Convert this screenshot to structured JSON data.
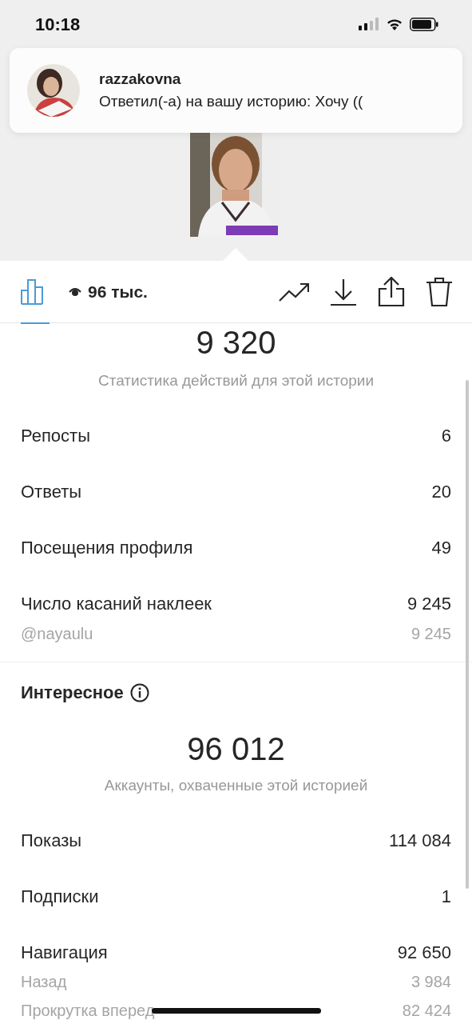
{
  "status_bar": {
    "time": "10:18"
  },
  "notification": {
    "username": "razzakovna",
    "message": "Ответил(-а) на вашу историю: Хочу (("
  },
  "toolbar": {
    "views": "96 тыс.",
    "tabs": [
      {
        "kind": "insights",
        "selected": true
      }
    ]
  },
  "sections": [
    {
      "big_number": "9 320",
      "caption": "Статистика действий для этой истории",
      "rows": [
        {
          "kind": "main",
          "label": "Репосты",
          "value": "6"
        },
        {
          "kind": "main",
          "label": "Ответы",
          "value": "20"
        },
        {
          "kind": "main",
          "label": "Посещения профиля",
          "value": "49"
        },
        {
          "kind": "main",
          "label": "Число касаний наклеек",
          "value": "9 245"
        },
        {
          "kind": "sub",
          "label": "@nayaulu",
          "value": "9 245"
        }
      ]
    },
    {
      "heading": "Интересное",
      "big_number": "96 012",
      "caption": "Аккаунты, охваченные этой историей",
      "rows": [
        {
          "kind": "main",
          "label": "Показы",
          "value": "114 084"
        },
        {
          "kind": "main",
          "label": "Подписки",
          "value": "1"
        },
        {
          "kind": "main",
          "label": "Навигация",
          "value": "92 650"
        },
        {
          "kind": "sub",
          "label": "Назад",
          "value": "3 984"
        },
        {
          "kind": "sub",
          "label": "Прокрутка вперед",
          "value": "82 424"
        }
      ]
    }
  ]
}
